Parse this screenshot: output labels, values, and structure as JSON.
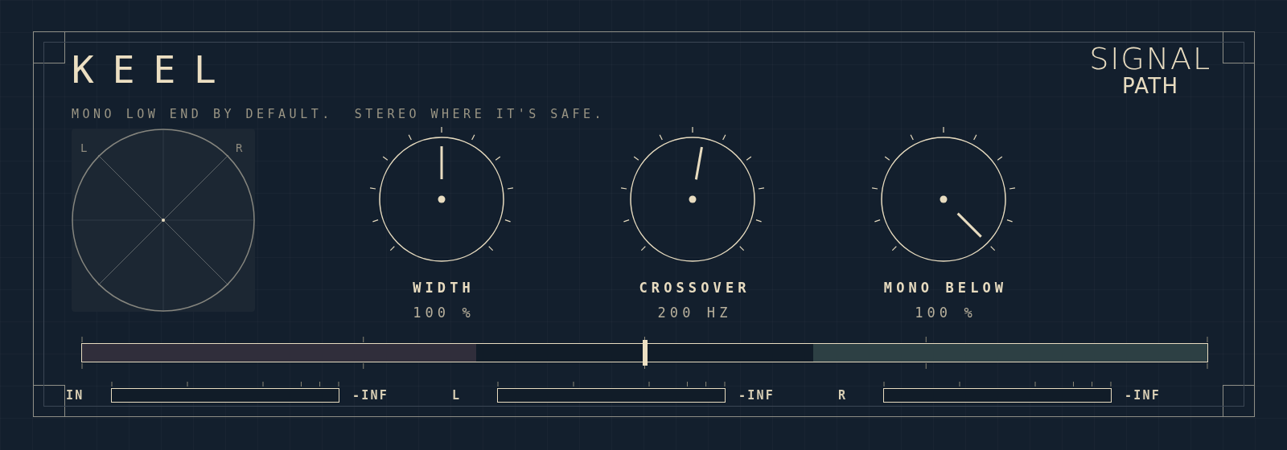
{
  "title": "KEEL",
  "tagline": "MONO LOW END BY DEFAULT.  STEREO WHERE IT'S SAFE.",
  "logo": {
    "line_1": "SIGNAL",
    "line_2": "PATH"
  },
  "scope": {
    "left_label": "L",
    "right_label": "R"
  },
  "knobs": [
    {
      "label": "WIDTH",
      "value": "100 %"
    },
    {
      "label": "CROSSOVER",
      "value": "200 HZ"
    },
    {
      "label": "MONO BELOW",
      "value": "100 %"
    }
  ],
  "band_bar": {
    "marker": {
      "level": 0.5
    },
    "mono_band": {
      "level": 0.35
    },
    "stereo_band": {
      "level": 0.35
    }
  },
  "meters": [
    {
      "label": "IN",
      "reading": "-INF"
    },
    {
      "label": "L",
      "reading": "-INF"
    },
    {
      "label": "R",
      "reading": "-INF"
    }
  ]
}
